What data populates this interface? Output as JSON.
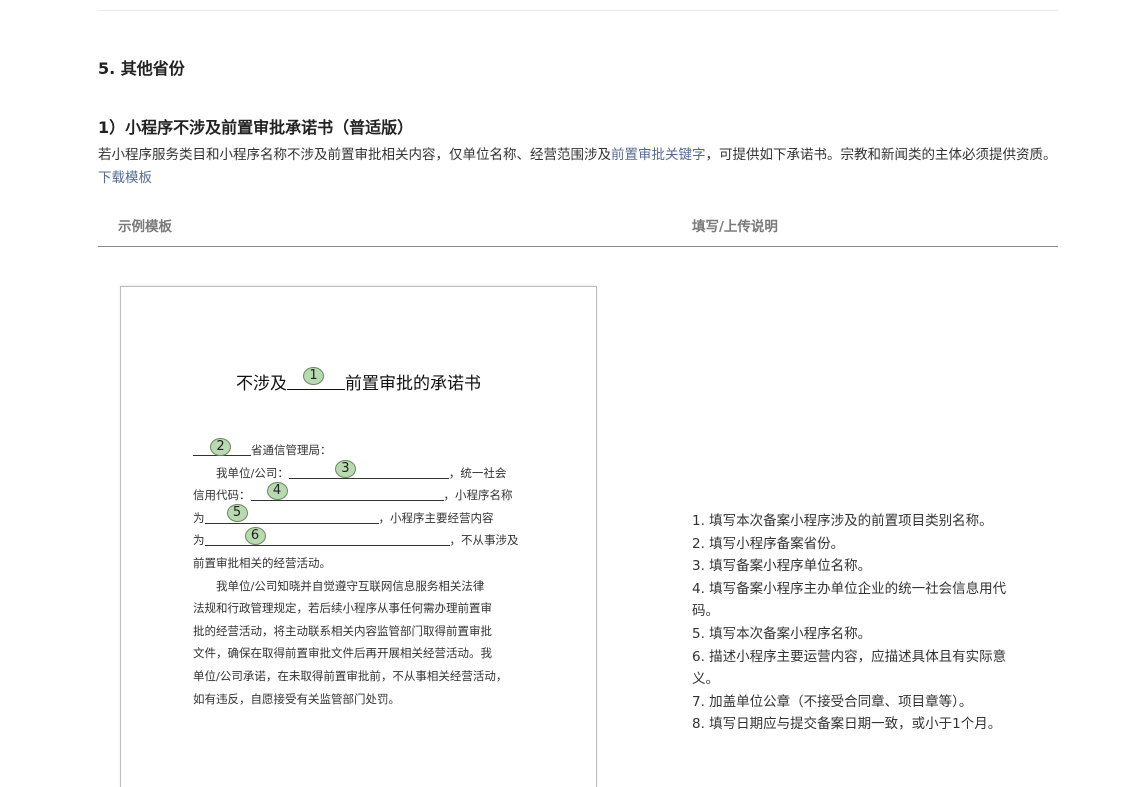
{
  "section": {
    "title": "5. 其他省份"
  },
  "subsection": {
    "title": "1）小程序不涉及前置审批承诺书（普适版）"
  },
  "intro": {
    "text_before": "若小程序服务类目和小程序名称不涉及前置审批相关内容，仅单位名称、经营范围涉及",
    "link_keywords": "前置审批关键字",
    "text_mid": "，可提供如下承诺书。宗教和新闻类的主体必须提供资质。",
    "link_download": "下载模板"
  },
  "table": {
    "col_left": "示例模板",
    "col_right": "填写/上传说明"
  },
  "doc": {
    "title_prefix": "不涉及",
    "title_suffix": "前置审批的承诺书",
    "markers": [
      "1",
      "2",
      "3",
      "4",
      "5",
      "6"
    ],
    "addressee_suffix": "省通信管理局：",
    "line_unit_prefix": "我单位/公司：",
    "line_unit_suffix": "，统一社会",
    "line_credit_prefix": "信用代码：",
    "line_credit_suffix": "，小程序名称",
    "line_name_prefix": "为",
    "line_name_suffix": "，小程序主要经营内容",
    "line_content_prefix": "为",
    "line_content_suffix": "，不从事涉及",
    "line_activity": "前置审批相关的经营活动。",
    "para2": [
      "我单位/公司知晓并自觉遵守互联网信息服务相关法律",
      "法规和行政管理规定，若后续小程序从事任何需办理前置审",
      "批的经营活动，将主动联系相关内容监管部门取得前置审批",
      "文件，确保在取得前置审批文件后再开展相关经营活动。我",
      "单位/公司承诺，在未取得前置审批前，不从事相关经营活动，",
      "如有违反，自愿接受有关监管部门处罚。"
    ]
  },
  "notes": [
    "1. 填写本次备案小程序涉及的前置项目类别名称。",
    "2. 填写小程序备案省份。",
    "3. 填写备案小程序单位名称。",
    "4. 填写备案小程序主办单位企业的统一社会信息用代码。",
    "5. 填写本次备案小程序名称。",
    "6. 描述小程序主要运营内容，应描述具体且有实际意义。",
    "7. 加盖单位公章（不接受合同章、项目章等）。",
    "8. 填写日期应与提交备案日期一致，或小于1个月。"
  ]
}
